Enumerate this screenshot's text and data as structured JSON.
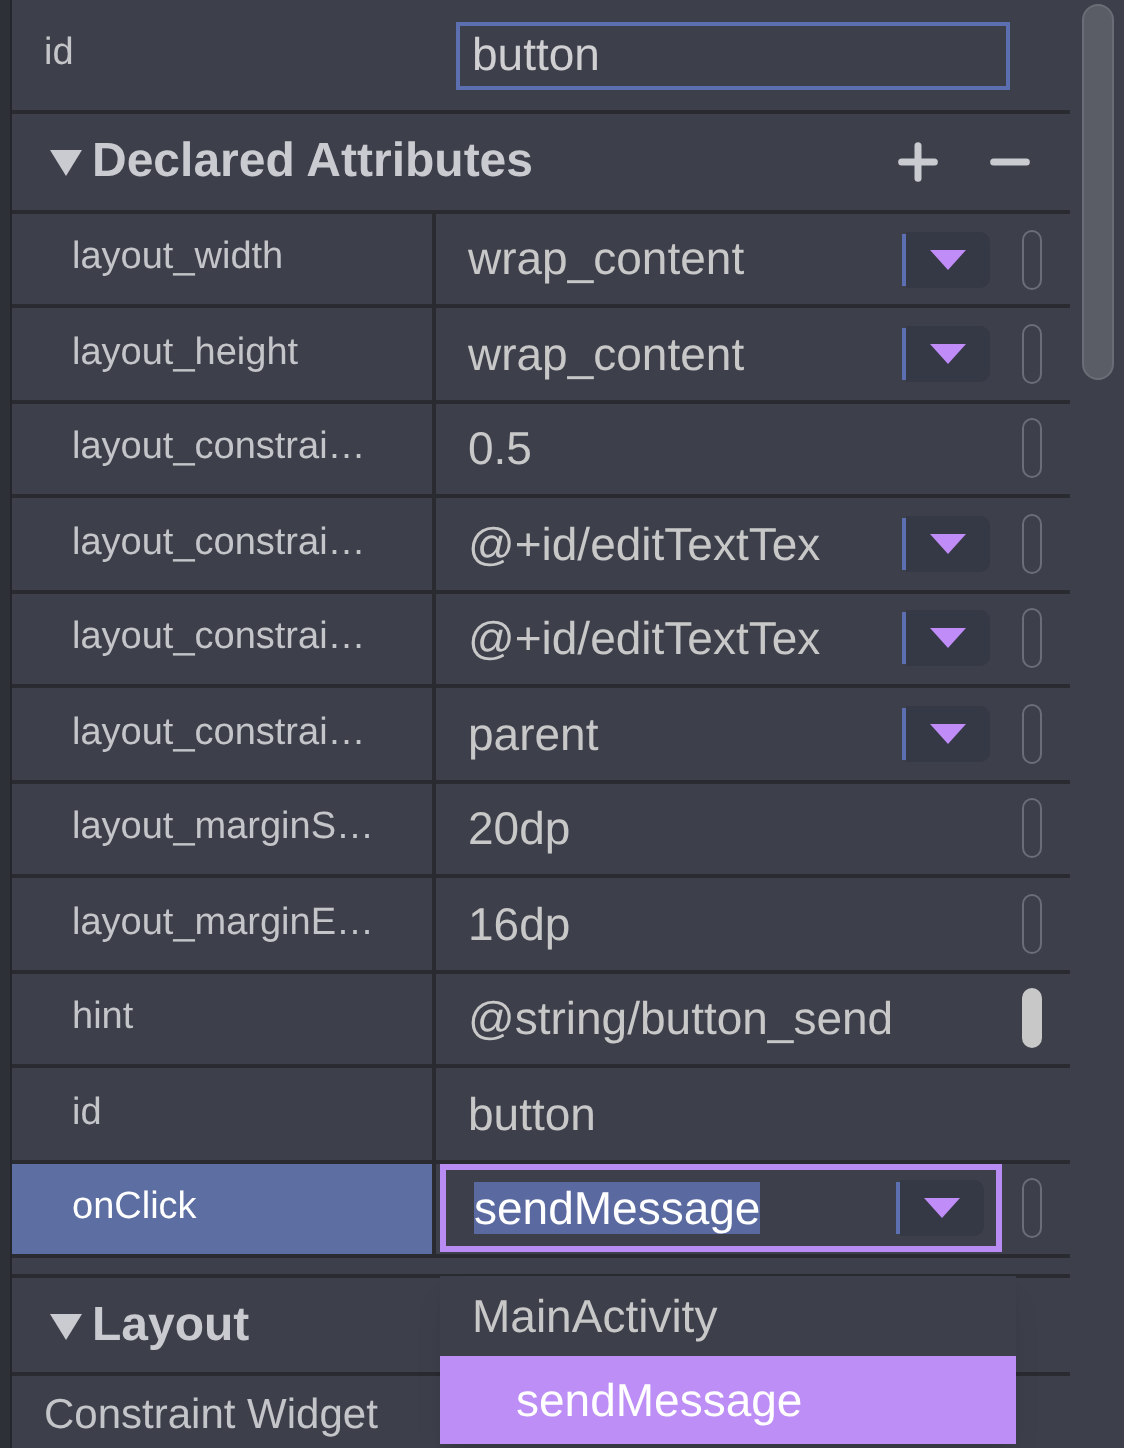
{
  "id_field": {
    "label": "id",
    "value": "button"
  },
  "declared_section": {
    "title": "Declared Attributes",
    "expanded": true
  },
  "attributes": [
    {
      "name": "layout_width",
      "value": "wrap_content",
      "kind": "dropdown",
      "selected": false,
      "has_indicator": true,
      "resource": false
    },
    {
      "name": "layout_height",
      "value": "wrap_content",
      "kind": "dropdown",
      "selected": false,
      "has_indicator": true,
      "resource": false
    },
    {
      "name": "layout_constrai…",
      "value": "0.5",
      "kind": "text",
      "selected": false,
      "has_indicator": true,
      "resource": false
    },
    {
      "name": "layout_constrai…",
      "value": "@+id/editTextTex",
      "kind": "dropdown",
      "selected": false,
      "has_indicator": true,
      "resource": false
    },
    {
      "name": "layout_constrai…",
      "value": "@+id/editTextTex",
      "kind": "dropdown",
      "selected": false,
      "has_indicator": true,
      "resource": false
    },
    {
      "name": "layout_constrai…",
      "value": "parent",
      "kind": "dropdown",
      "selected": false,
      "has_indicator": true,
      "resource": false
    },
    {
      "name": "layout_marginS…",
      "value": "20dp",
      "kind": "text",
      "selected": false,
      "has_indicator": true,
      "resource": false
    },
    {
      "name": "layout_marginE…",
      "value": "16dp",
      "kind": "text",
      "selected": false,
      "has_indicator": true,
      "resource": false
    },
    {
      "name": "hint",
      "value": "@string/button_send",
      "kind": "text",
      "selected": false,
      "has_indicator": true,
      "resource": true
    },
    {
      "name": "id",
      "value": "button",
      "kind": "plain",
      "selected": false,
      "has_indicator": false
    },
    {
      "name": "onClick",
      "value": "sendMessage",
      "kind": "editing",
      "selected": true,
      "has_indicator": true,
      "resource": false
    }
  ],
  "popup": {
    "group": "MainActivity",
    "options": [
      {
        "label": "sendMessage",
        "selected": true
      }
    ]
  },
  "layout_section": {
    "title": "Layout",
    "expanded": true
  },
  "layout_item": "Constraint Widget"
}
